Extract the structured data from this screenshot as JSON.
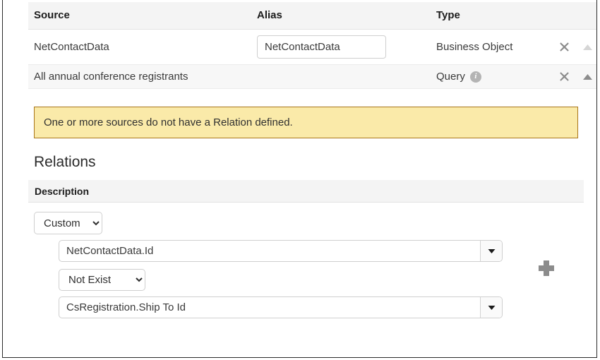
{
  "sources_table": {
    "columns": [
      "Source",
      "Alias",
      "Type"
    ],
    "rows": [
      {
        "source": "NetContactData",
        "alias_value": "NetContactData",
        "alias_placeholder": "",
        "type": "Business Object",
        "has_info_icon": false,
        "remove_label": "✖",
        "move_up_enabled": false,
        "move_down_enabled": true
      },
      {
        "source": "All annual conference registrants",
        "alias_value": "",
        "alias_placeholder": "",
        "type": "Query",
        "has_info_icon": true,
        "info_icon_label": "i",
        "remove_label": "✖",
        "move_up_enabled": true,
        "move_down_enabled": false
      }
    ]
  },
  "warning": {
    "message": "One or more sources do not have a Relation defined.",
    "background": "#faeaa9",
    "border_color": "#a8751a"
  },
  "relations": {
    "heading": "Relations",
    "description_header": "Description",
    "relation_type": {
      "selected": "Custom",
      "options": [
        "Custom"
      ]
    },
    "left_operand": {
      "value": "NetContactData.Id",
      "placeholder": ""
    },
    "operator": {
      "selected": "Not Exist",
      "options": [
        "Not Exist"
      ]
    },
    "right_operand": {
      "value": "CsRegistration.Ship To Id",
      "placeholder": ""
    },
    "add_button_label": "+"
  },
  "colors": {
    "header_background": "#f4f4f4",
    "row_stripe": "#f7f7f7",
    "icon_gray": "#8c8c8c",
    "icon_disabled": "#d0d0d0"
  }
}
